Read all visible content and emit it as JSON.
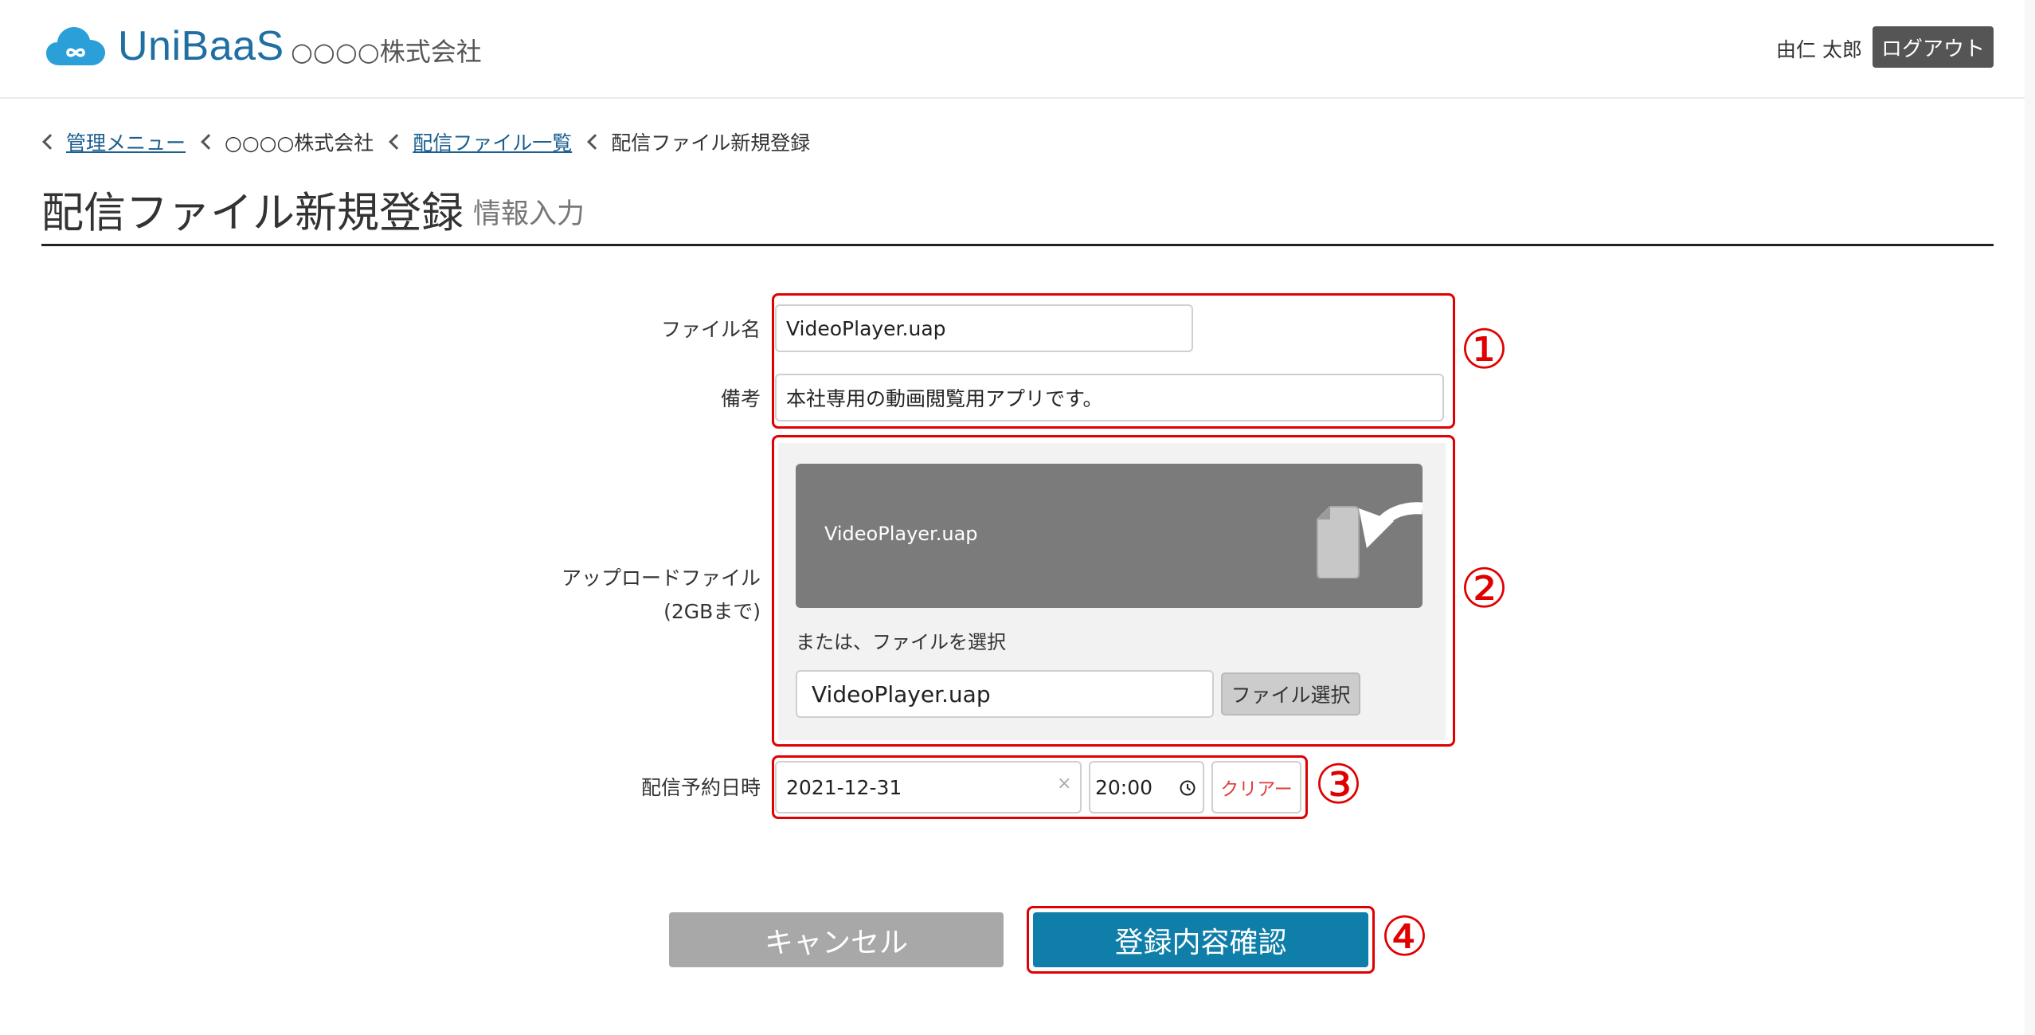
{
  "header": {
    "brand": "UniBaaS",
    "company": "○○○○株式会社",
    "user_name": "由仁 太郎",
    "logout_label": "ログアウト"
  },
  "breadcrumb": [
    {
      "label": "管理メニュー",
      "link": true
    },
    {
      "label": "○○○○株式会社",
      "link": false
    },
    {
      "label": "配信ファイル一覧",
      "link": true
    },
    {
      "label": "配信ファイル新規登録",
      "link": false
    }
  ],
  "page": {
    "title": "配信ファイル新規登録",
    "subtitle": "情報入力"
  },
  "form": {
    "filename_label": "ファイル名",
    "filename_value": "VideoPlayer.uap",
    "note_label": "備考",
    "note_value": "本社専用の動画閲覧用アプリです。",
    "upload_label_line1": "アップロードファイル",
    "upload_label_line2": "(2GBまで)",
    "dropzone_filename": "VideoPlayer.uap",
    "alt_select_text": "または、ファイルを選択",
    "file_path_value": "VideoPlayer.uap",
    "file_select_label": "ファイル選択",
    "schedule_label": "配信予約日時",
    "date_value": "2021-12-31",
    "date_clear_glyph": "×",
    "time_value": "20:00",
    "clear_label": "クリアー"
  },
  "actions": {
    "cancel_label": "キャンセル",
    "confirm_label": "登録内容確認"
  },
  "annotations": [
    "①",
    "②",
    "③",
    "④"
  ],
  "colors": {
    "brand": "#1f6fa3",
    "logo_cloud": "#2a9fd8",
    "annotation_red": "#e00000",
    "confirm_button": "#0f7ea8",
    "cancel_button": "#a8a8a8",
    "dropzone": "#7b7b7b"
  },
  "icons": {
    "logo": "cloud-infinity-icon",
    "drop": "file-drop-arrow-icon",
    "clock": "clock-icon",
    "breadcrumb_separator": "chevron-left-icon"
  }
}
